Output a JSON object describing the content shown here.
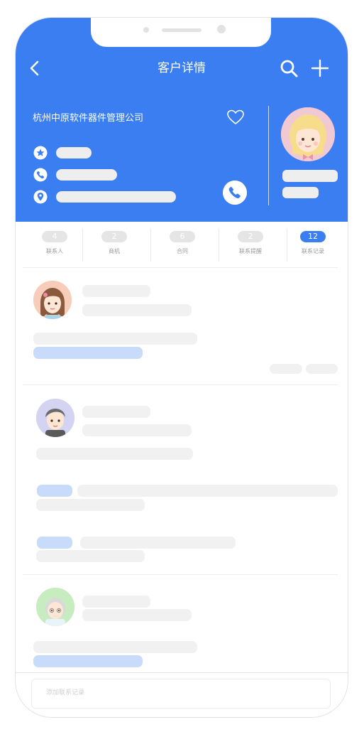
{
  "nav": {
    "title": "客户详情"
  },
  "customer": {
    "company": "杭州中原软件器件管理公司"
  },
  "tabs": [
    {
      "count": "4",
      "label": "联系人"
    },
    {
      "count": "2",
      "label": "商机"
    },
    {
      "count": "6",
      "label": "合同"
    },
    {
      "count": "2",
      "label": "联系提醒"
    },
    {
      "count": "12",
      "label": "联系记录",
      "active": true
    }
  ],
  "footer": {
    "placeholder": "添加联系记录"
  },
  "colors": {
    "primary": "#3a7ef2",
    "skeleton": "#f1f1f1",
    "skeleton_blue": "#c8dbfb"
  },
  "icons": [
    "back-icon",
    "search-icon",
    "plus-icon",
    "heart-icon",
    "star-icon",
    "phone-icon",
    "location-icon",
    "call-icon"
  ]
}
